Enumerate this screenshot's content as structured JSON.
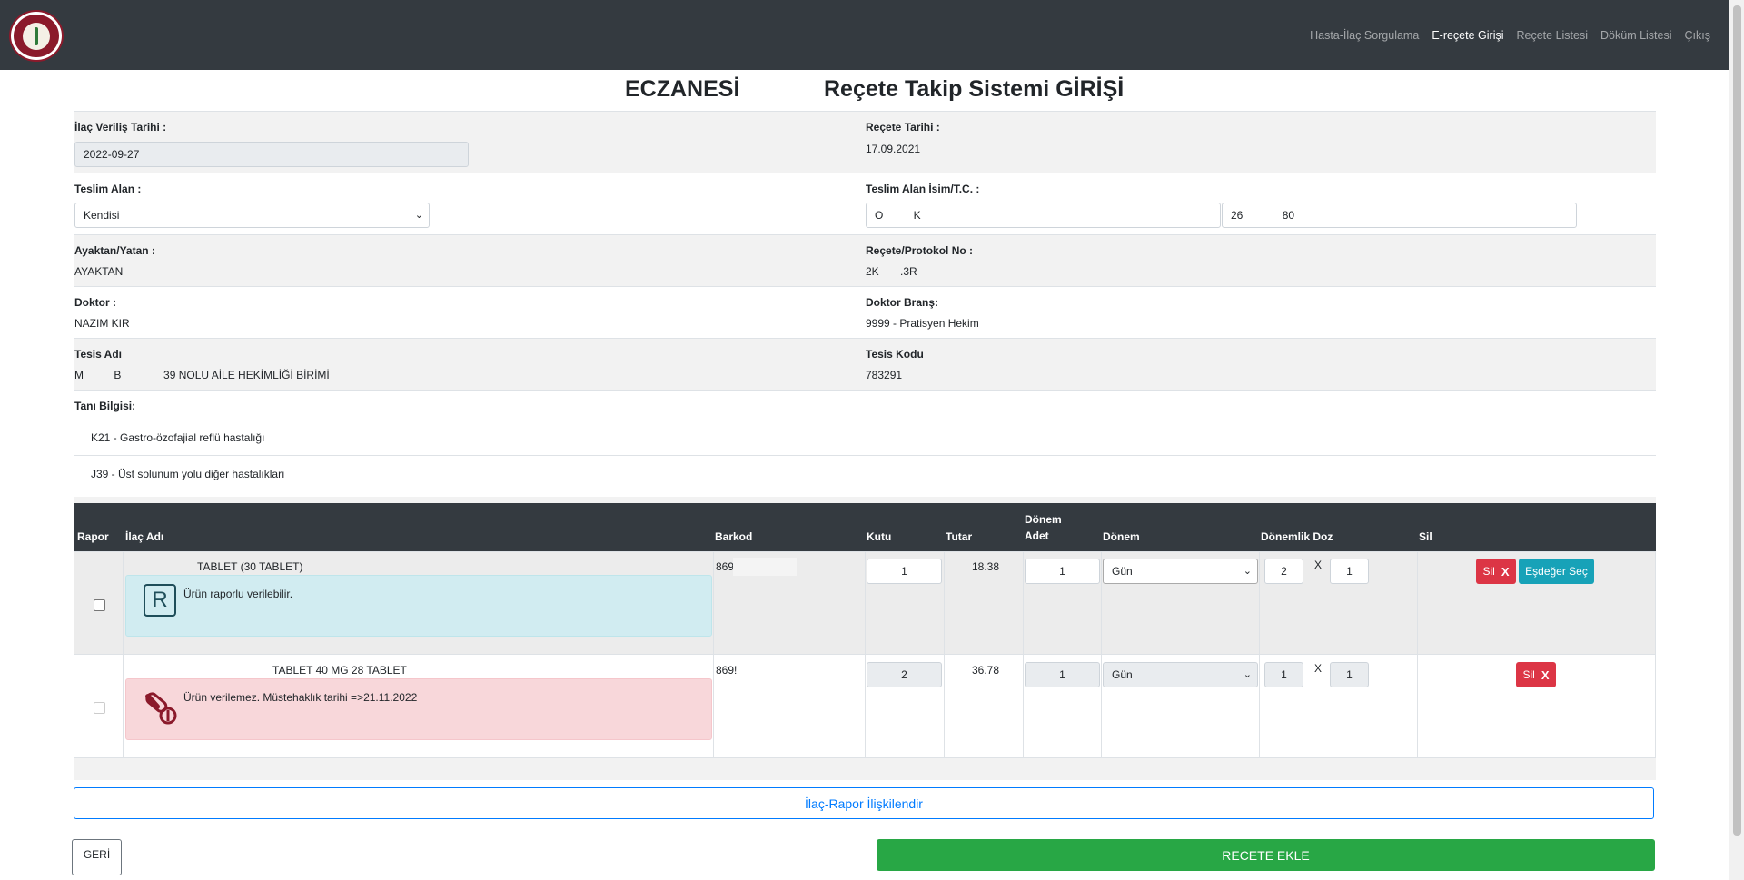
{
  "nav": {
    "links": [
      "Hasta-İlaç Sorgulama",
      "E-reçete Girişi",
      "Reçete Listesi",
      "Döküm Listesi",
      "Çıkış"
    ]
  },
  "title": {
    "left": "ECZANESİ",
    "right": "Reçete Takip Sistemi GİRİŞİ"
  },
  "form": {
    "ilac_verilis_label": "İlaç Veriliş Tarihi :",
    "ilac_verilis_value": "2022-09-27",
    "recete_tarihi_label": "Reçete Tarihi :",
    "recete_tarihi_value": "17.09.2021",
    "teslim_alan_label": "Teslim Alan :",
    "teslim_alan_value": "Kendisi",
    "teslim_isim_label": "Teslim Alan İsim/T.C. :",
    "teslim_isim_value": "O          K",
    "teslim_tc_value": "26             80",
    "ayaktan_label": "Ayaktan/Yatan :",
    "ayaktan_value": "AYAKTAN",
    "protokol_label": "Reçete/Protokol No :",
    "protokol_value": "2K       .3R",
    "doktor_label": "Doktor :",
    "doktor_value": "NAZIM KIR",
    "brans_label": "Doktor Branş:",
    "brans_value": "9999 - Pratisyen Hekim",
    "tesis_adi_label": "Tesis Adı",
    "tesis_adi_value": "M          B              39 NOLU AİLE HEKİMLİĞİ BİRİMİ",
    "tesis_kodu_label": "Tesis Kodu",
    "tesis_kodu_value": "783291",
    "tani_label": "Tanı Bilgisi:",
    "tani": [
      "K21 - Gastro-özofajial reflü hastalığı",
      "J39 - Üst solunum yolu diğer hastalıkları"
    ]
  },
  "table": {
    "headers": {
      "rapor": "Rapor",
      "ilac_adi": "İlaç Adı",
      "barkod": "Barkod",
      "kutu": "Kutu",
      "tutar": "Tutar",
      "donem_adet_1": "Dönem",
      "donem_adet_2": "Adet",
      "donem": "Dönem",
      "donemlik_doz": "Dönemlik Doz",
      "sil": "Sil"
    },
    "rows": [
      {
        "name": "TABLET (30 TABLET)",
        "alert": "Ürün raporlu verilebilir.",
        "barkod": "869",
        "kutu": "1",
        "tutar": "18.38",
        "donem_adet": "1",
        "donem": "Gün",
        "doz1": "2",
        "doz_x": "X",
        "doz2": "1",
        "sil": "Sil",
        "sil_x": "X",
        "esdeger": "Eşdeğer Seç"
      },
      {
        "name": "TABLET 40 MG 28 TABLET",
        "alert": "Ürün verilemez. Müstehaklık tarihi =>21.11.2022",
        "barkod": "869!",
        "kutu": "2",
        "tutar": "36.78",
        "donem_adet": "1",
        "donem": "Gün",
        "doz1": "1",
        "doz_x": "X",
        "doz2": "1",
        "sil": "Sil",
        "sil_x": "X"
      }
    ]
  },
  "buttons": {
    "iliskilendir": "İlaç-Rapor İlişkilendir",
    "geri": "GERİ",
    "recete_ekle": "RECETE EKLE"
  },
  "icons": {
    "logo": "pharmacy-logo",
    "report": "report-r-icon",
    "pill": "pill-forbidden-icon"
  },
  "colors": {
    "navbar": "#343a40",
    "info_alert": "#d1ecf1",
    "danger_alert": "#f8d7da",
    "danger": "#dc3545",
    "info": "#17a2b8",
    "success": "#28a745",
    "primary": "#007bff"
  }
}
